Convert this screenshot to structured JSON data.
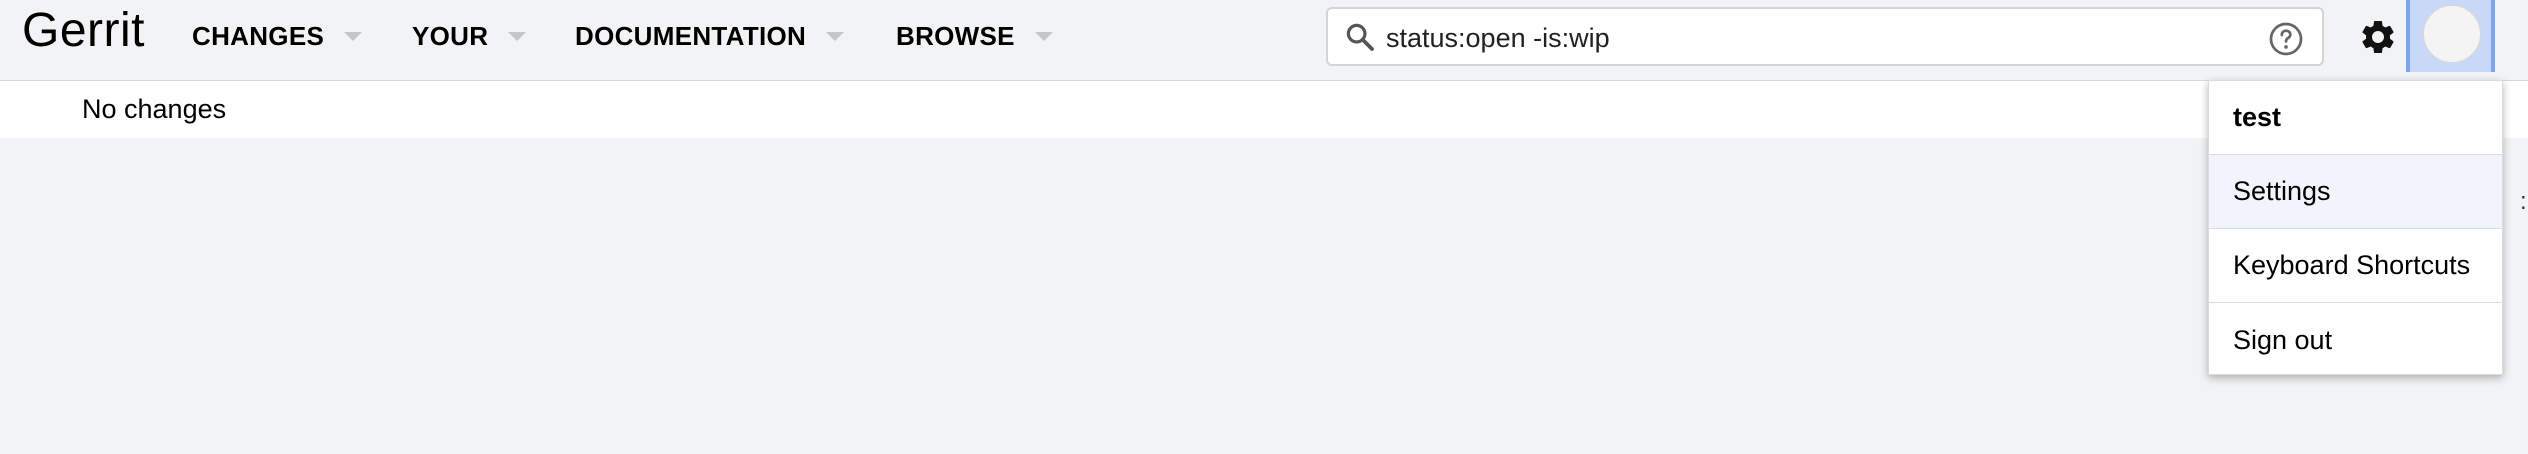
{
  "app": {
    "title": "Gerrit"
  },
  "nav": {
    "items": [
      {
        "label": "CHANGES"
      },
      {
        "label": "YOUR"
      },
      {
        "label": "DOCUMENTATION"
      },
      {
        "label": "BROWSE"
      }
    ]
  },
  "search": {
    "value": "status:open -is:wip",
    "icon": "search-icon",
    "help_icon": "help-icon"
  },
  "toolbar": {
    "settings_icon": "gear-icon",
    "avatar": "avatar"
  },
  "main": {
    "empty_message": "No changes"
  },
  "account_menu": {
    "user_name": "test",
    "items": [
      {
        "label": "Settings"
      },
      {
        "label": "Keyboard Shortcuts"
      },
      {
        "label": "Sign out"
      }
    ]
  },
  "colors": {
    "header_bg": "#f1f3f4",
    "focus_ring": "#7aa5f0",
    "menu_hover": "#f1f4fb"
  }
}
